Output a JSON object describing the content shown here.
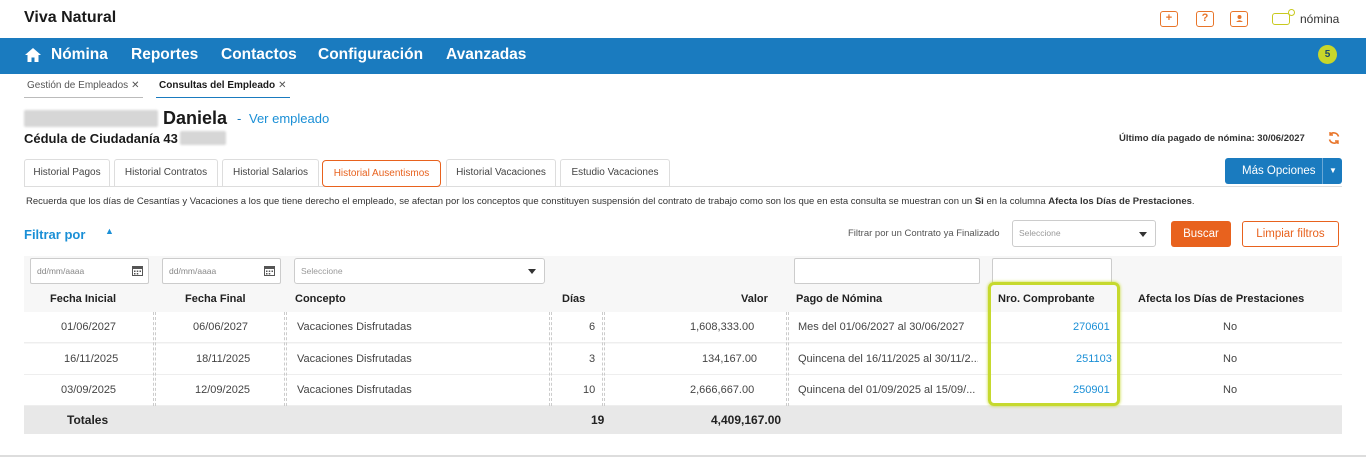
{
  "app": {
    "brand": "Viva Natural",
    "user_name": "nómina",
    "top_icons": [
      "plus-icon",
      "help-icon",
      "user-icon"
    ]
  },
  "nav": {
    "items": [
      "Nómina",
      "Reportes",
      "Contactos",
      "Configuración",
      "Avanzadas"
    ],
    "badge": "5"
  },
  "subtabs": [
    {
      "label": "Gestión de Empleados",
      "close": "✕"
    },
    {
      "label": "Consultas del Empleado",
      "close": "✕"
    }
  ],
  "employee": {
    "first_name": "Daniela",
    "separator": "-",
    "view_link": "Ver empleado",
    "id_label": "Cédula de Ciudadanía 43"
  },
  "last_paid": "Último día pagado de nómina: 30/06/2027",
  "history_tabs": [
    "Historial Pagos",
    "Historial Contratos",
    "Historial Salarios",
    "Historial Ausentismos",
    "Historial Vacaciones",
    "Estudio Vacaciones"
  ],
  "more_options": "Más Opciones",
  "notice": {
    "part1": "Recuerda que los días de Cesantías y Vacaciones a los que tiene derecho el empleado, se afectan por los conceptos que constituyen suspensión del contrato de trabajo como son los que en esta consulta se muestran con un ",
    "si": "Si",
    "part2": " en la columna ",
    "col": "Afecta los Días de Prestaciones",
    "end": "."
  },
  "filters": {
    "toggle": "Filtrar por",
    "contract_label": "Filtrar por un Contrato ya Finalizado",
    "contract_placeholder": "Seleccione",
    "search": "Buscar",
    "clear": "Limpiar filtros",
    "date_placeholder": "dd/mm/aaaa",
    "concept_placeholder": "Seleccione"
  },
  "table": {
    "headers": [
      "Fecha Inicial",
      "Fecha Final",
      "Concepto",
      "Días",
      "Valor",
      "Pago de Nómina",
      "Nro. Comprobante",
      "Afecta los Días de Prestaciones"
    ],
    "rows": [
      [
        "01/06/2027",
        "06/06/2027",
        "Vacaciones Disfrutadas",
        "6",
        "1,608,333.00",
        "Mes del 01/06/2027 al 30/06/2027",
        "270601",
        "No"
      ],
      [
        "16/11/2025",
        "18/11/2025",
        "Vacaciones Disfrutadas",
        "3",
        "134,167.00",
        "Quincena del 16/11/2025 al 30/11/2...",
        "251103",
        "No"
      ],
      [
        "03/09/2025",
        "12/09/2025",
        "Vacaciones Disfrutadas",
        "10",
        "2,666,667.00",
        "Quincena del 01/09/2025 al 15/09/...",
        "250901",
        "No"
      ]
    ],
    "totals": {
      "label": "Totales",
      "days": "19",
      "value": "4,409,167.00"
    }
  }
}
